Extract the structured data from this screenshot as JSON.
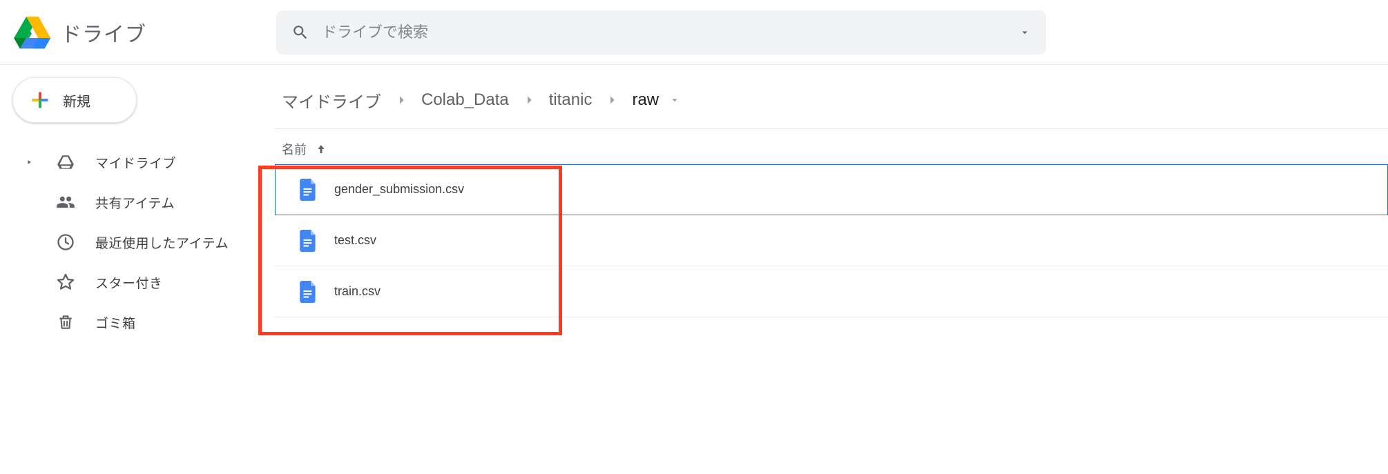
{
  "brand": {
    "name": "ドライブ"
  },
  "search": {
    "placeholder": "ドライブで検索"
  },
  "sidebar": {
    "new_label": "新規",
    "items": [
      {
        "label": "マイドライブ",
        "icon": "drive",
        "expandable": true
      },
      {
        "label": "共有アイテム",
        "icon": "shared"
      },
      {
        "label": "最近使用したアイテム",
        "icon": "recent"
      },
      {
        "label": "スター付き",
        "icon": "star"
      },
      {
        "label": "ゴミ箱",
        "icon": "trash"
      }
    ]
  },
  "breadcrumb": {
    "items": [
      "マイドライブ",
      "Colab_Data",
      "titanic",
      "raw"
    ]
  },
  "columns": {
    "name": "名前"
  },
  "files": [
    {
      "name": "gender_submission.csv",
      "selected": true
    },
    {
      "name": "test.csv",
      "selected": false
    },
    {
      "name": "train.csv",
      "selected": false
    }
  ]
}
